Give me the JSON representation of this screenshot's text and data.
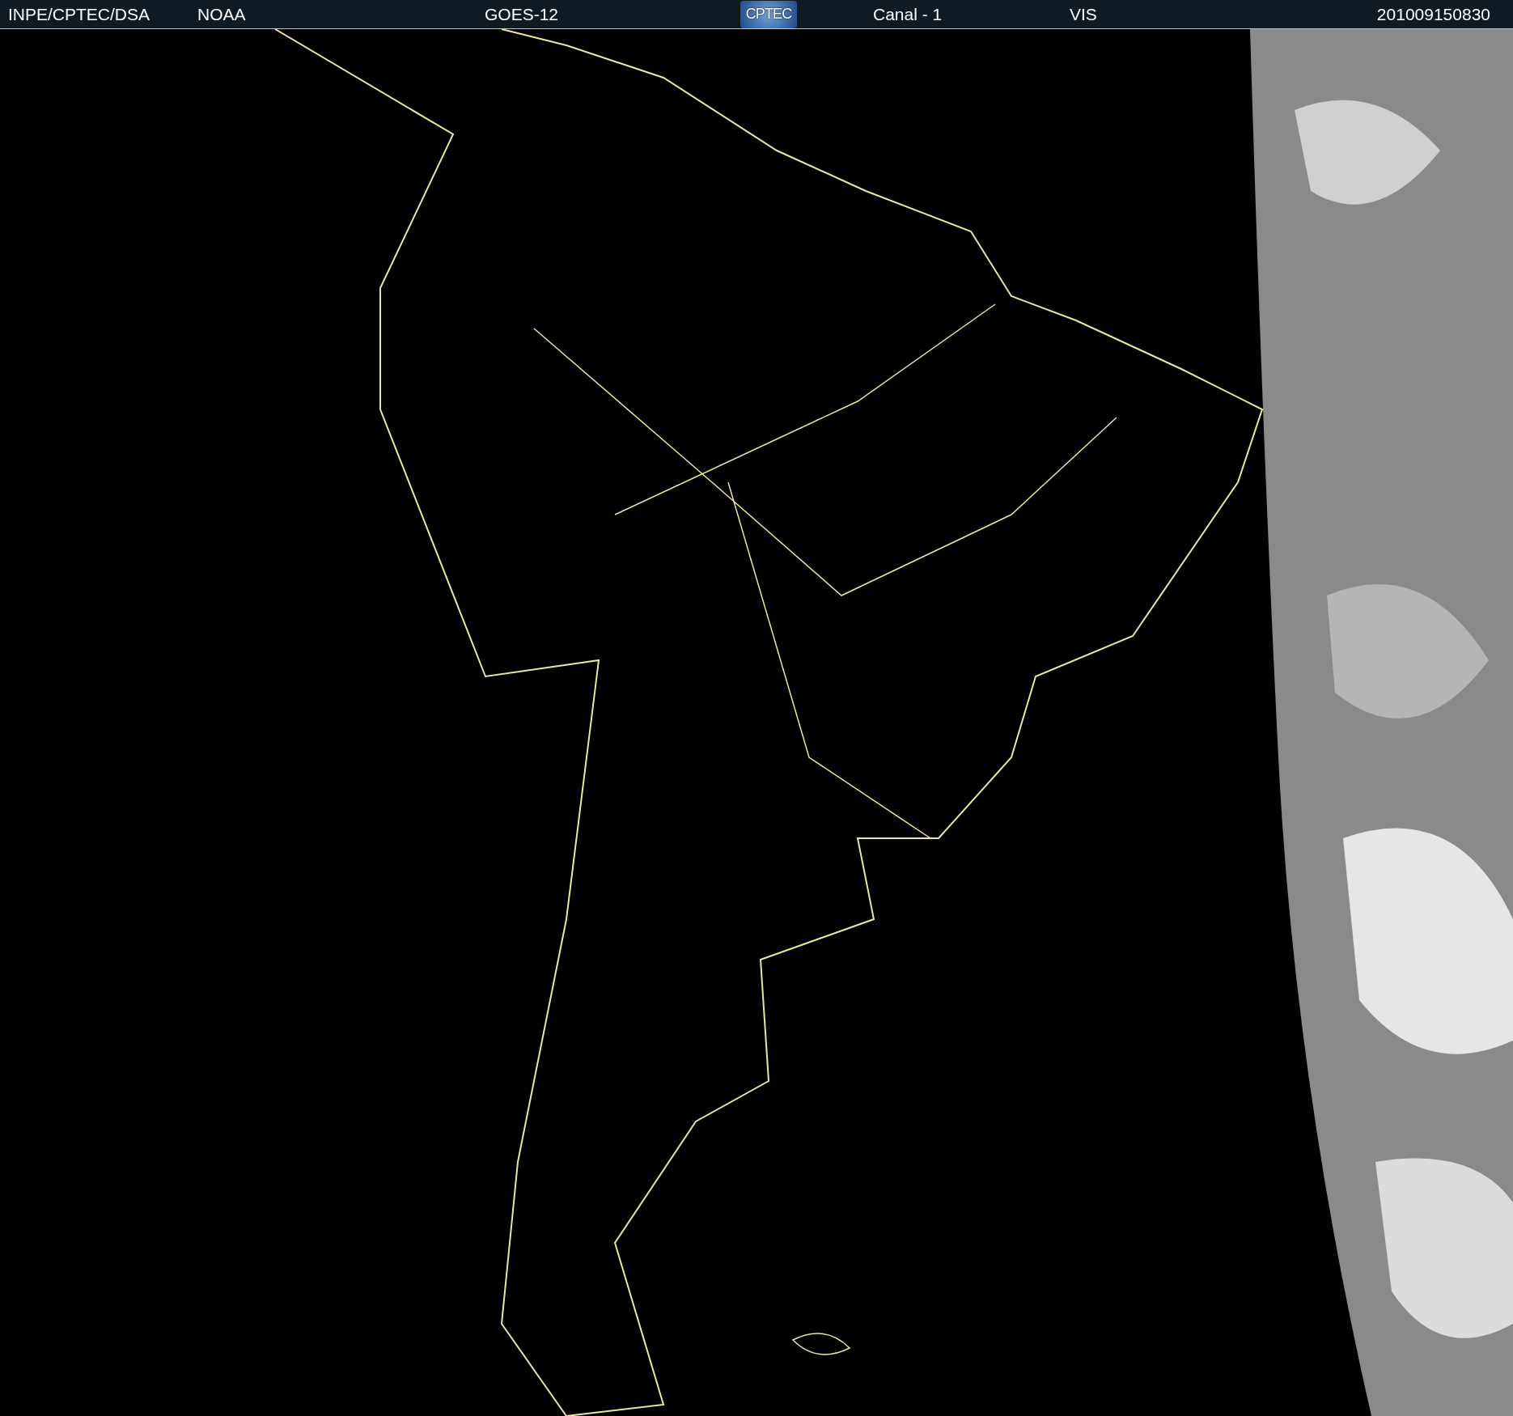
{
  "header": {
    "items": [
      {
        "kind": "text",
        "text": "INPE/CPTEC/DSA"
      },
      {
        "kind": "text",
        "text": "NOAA"
      },
      {
        "kind": "text",
        "text": "GOES-12"
      },
      {
        "kind": "logo",
        "text": "CPTEC"
      },
      {
        "kind": "text",
        "text": "Canal - 1"
      },
      {
        "kind": "text",
        "text": "VIS"
      },
      {
        "kind": "text",
        "text": "201009150830"
      }
    ]
  }
}
